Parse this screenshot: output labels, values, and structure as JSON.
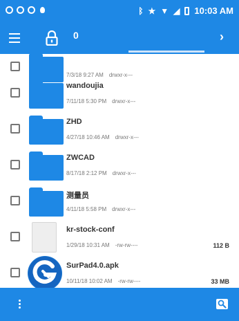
{
  "status_bar": {
    "time": "10:03 AM",
    "icons": [
      "notification-circle-icon",
      "notification-circle-icon",
      "notification-circle-icon",
      "location-pin-icon",
      "bluetooth-icon",
      "star-icon",
      "wifi-icon",
      "signal-icon",
      "battery-icon"
    ]
  },
  "toolbar": {
    "menu_icon": "hamburger-menu-icon",
    "lock_icon": "lock-icon",
    "breadcrumb": "0",
    "chevron_icon": "chevron-right-icon"
  },
  "files": [
    {
      "name": "",
      "date": "7/3/18 9:27 AM",
      "owner": "drwxr-x---",
      "size": "",
      "type": "folder"
    },
    {
      "name": "wandoujia",
      "date": "7/11/18 5:30 PM",
      "owner": "drwxr-x---",
      "size": "",
      "type": "folder"
    },
    {
      "name": "ZHD",
      "date": "4/27/18 10:46 AM",
      "owner": "drwxr-x---",
      "size": "",
      "type": "folder"
    },
    {
      "name": "ZWCAD",
      "date": "8/17/18 2:12 PM",
      "owner": "drwxr-x---",
      "size": "",
      "type": "folder"
    },
    {
      "name": "测量员",
      "date": "4/11/18 5:58 PM",
      "owner": "drwxr-x---",
      "size": "",
      "type": "folder"
    },
    {
      "name": "kr-stock-conf",
      "date": "1/29/18 10:31 AM",
      "owner": "-rw-rw----",
      "size": "112 B",
      "type": "file"
    },
    {
      "name": "SurPad4.0.apk",
      "date": "10/11/18 10:02 AM",
      "owner": "-rw-rw----",
      "size": "33 MB",
      "type": "apk"
    }
  ],
  "bottom_bar": {
    "more_icon": "more-vertical-icon",
    "search_icon": "search-icon"
  },
  "colors": {
    "accent": "#1e88e5",
    "folder": "#1e88e5"
  }
}
